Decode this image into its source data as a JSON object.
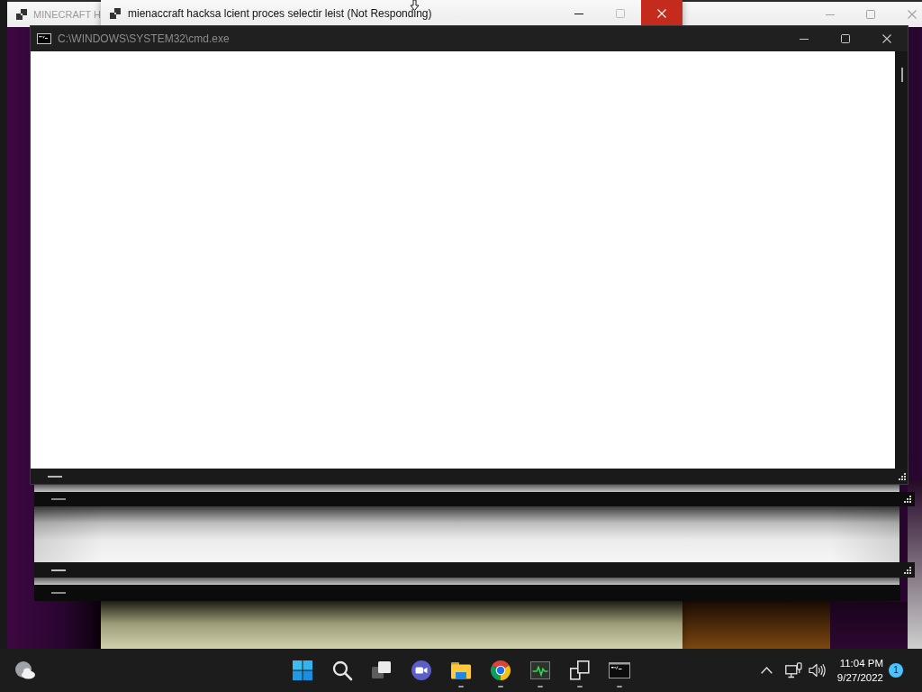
{
  "background_window": {
    "title": "MINECRAFT H"
  },
  "hung_window": {
    "title": "mienaccraft hacksa lcient proces selectir leist (Not Responding)"
  },
  "console_window": {
    "title": "C:\\WINDOWS\\SYSTEM32\\cmd.exe"
  },
  "taskbar": {
    "apps": [
      {
        "kind": "start",
        "running": false
      },
      {
        "kind": "search",
        "running": false
      },
      {
        "kind": "task-view",
        "running": false
      },
      {
        "kind": "chat",
        "running": false
      },
      {
        "kind": "file-explorer",
        "running": true
      },
      {
        "kind": "browser",
        "running": true
      },
      {
        "kind": "activity-monitor",
        "running": true
      },
      {
        "kind": "window-switcher",
        "running": true
      },
      {
        "kind": "terminal",
        "running": true
      }
    ],
    "clock": {
      "time": "11:04 PM",
      "date": "9/27/2022"
    },
    "notification_count": "1"
  }
}
